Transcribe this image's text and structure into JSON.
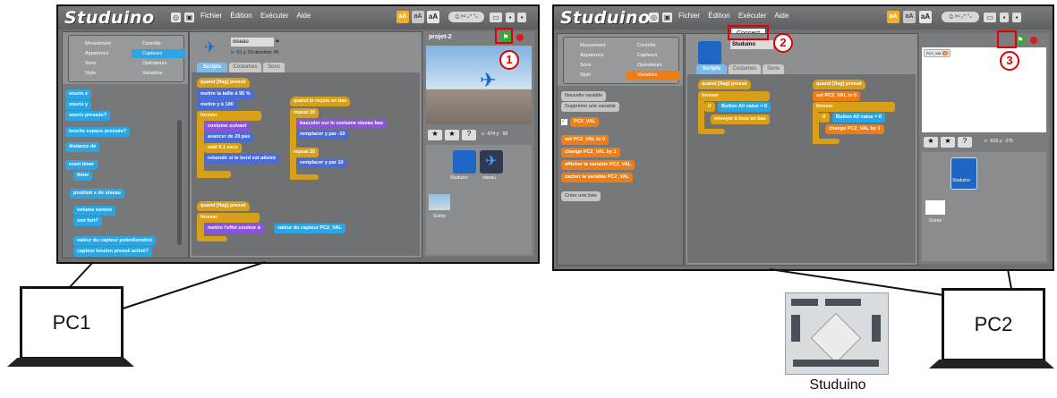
{
  "pc1": {
    "label": "PC1",
    "app": {
      "logo": "Studuino",
      "menu": [
        "Fichier",
        "Édition",
        "Exécuter",
        "Aide"
      ],
      "categories": [
        {
          "label": "Mouvement",
          "color": "#4a6cd4"
        },
        {
          "label": "Contrôle",
          "color": "#e3a129"
        },
        {
          "label": "Apparence",
          "color": "#8a55d7"
        },
        {
          "label": "Capteurs",
          "color": "#2ca5e2"
        },
        {
          "label": "Sons",
          "color": "#bb42c3"
        },
        {
          "label": "Opérateurs",
          "color": "#5cb712"
        },
        {
          "label": "Style",
          "color": "#0e9a6c"
        },
        {
          "label": "Variables",
          "color": "#ee7d16"
        }
      ],
      "palette_blocks": [
        "souris x",
        "souris y",
        "souris pressée?",
        "touche espace pressée?",
        "distance de",
        "reset timer",
        "timer",
        "position x de oiseau",
        "volume sonore",
        "son fort?",
        "valeur du capteur potentiomètre",
        "capteur bouton pressé activé?"
      ],
      "sprite_name": "oiseau",
      "sprite_coords": "x: -51   y: 59   direction: 45",
      "tabs": [
        "Scripts",
        "Costumes",
        "Sons"
      ],
      "scripts": {
        "s1": [
          "quand [flag] pressé",
          "mettre la taille à 95 %",
          "mettre y à 100",
          "forever",
          "costume suivant",
          "avancer de 20 pas",
          "wait 0.1 secs",
          "rebondir si le bord est atteint"
        ],
        "s2": [
          "quand je reçois en bas",
          "repeat 20",
          "basculer sur le costume oiseau bas",
          "remplacer y par -10",
          "repeat 20",
          "remplacer y par 10"
        ],
        "s3": [
          "quand [flag] pressé",
          "forever",
          "mettre l'effet couleur à",
          "valeur du capteur PC2_VAL"
        ]
      },
      "stage_title": "projet-2",
      "stage_coords": "x: -874   y: -58",
      "sprites": [
        {
          "label": "Studuino",
          "icon": "studuino-tile-icon"
        },
        {
          "label": "oiseau",
          "icon": "bird-sprite-icon"
        }
      ],
      "stage_label": "Scène",
      "callout": "1"
    }
  },
  "pc2": {
    "label": "PC2",
    "app": {
      "logo": "Studuino",
      "menu": [
        "Fichier",
        "Édition",
        "Exécuter",
        "Aide"
      ],
      "connect_menu": "Connect",
      "categories": [
        {
          "label": "Mouvement",
          "color": "#4a6cd4"
        },
        {
          "label": "Contrôle",
          "color": "#e3a129"
        },
        {
          "label": "Apparence",
          "color": "#8a55d7"
        },
        {
          "label": "Capteurs",
          "color": "#2ca5e2"
        },
        {
          "label": "Sons",
          "color": "#bb42c3"
        },
        {
          "label": "Opérateurs",
          "color": "#5cb712"
        },
        {
          "label": "Style",
          "color": "#0e9a6c"
        },
        {
          "label": "Variables",
          "color": "#ee7d16"
        }
      ],
      "var_buttons": [
        "Nouvelle variable",
        "Supprimer une variable"
      ],
      "var_name": "PC2_VAL",
      "var_blocks": [
        "set PC2_VAL to 0",
        "change PC2_VAL by 1",
        "afficher la variable PC2_VAL",
        "cacher la variable PC2_VAL"
      ],
      "list_button": "Créer une liste",
      "sprite_name": "Studuino",
      "tabs": [
        "Scripts",
        "Costumes",
        "Sons"
      ],
      "scripts": {
        "s1": [
          "quand [flag] pressé",
          "forever",
          "if",
          "Button A0 value = 0",
          "envoyer à tous en bas"
        ],
        "s2": [
          "quand [flag] pressé",
          "set PC2_VAL to 0",
          "forever",
          "if",
          "Button A0 value = 0",
          "change PC2_VAL by 1"
        ]
      },
      "stage_coords": "x: -816   y: -276",
      "sprites": [
        {
          "label": "Studuino",
          "icon": "studuino-tile-icon"
        }
      ],
      "stage_label": "Scène",
      "monitor": "PC2_VAL",
      "callouts": [
        "2",
        "3"
      ]
    }
  },
  "board_label": "Studuino",
  "colors": {
    "callout": "#e00000"
  }
}
